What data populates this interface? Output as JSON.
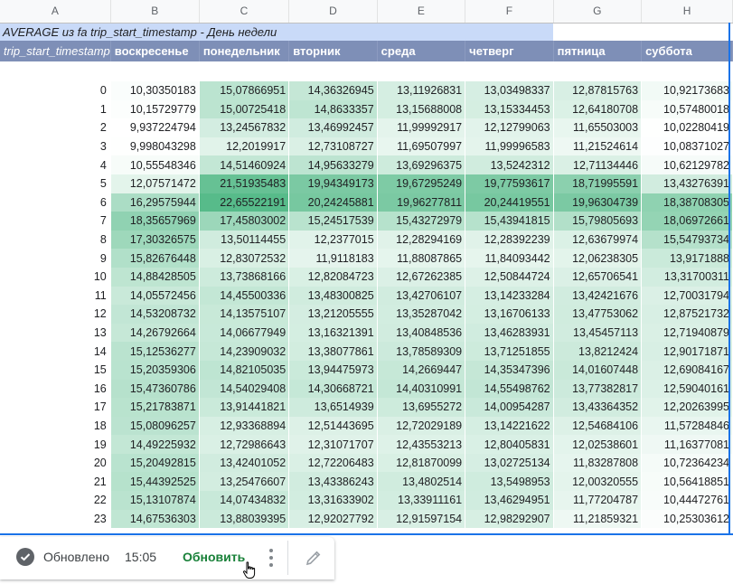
{
  "sheet": {
    "column_letters": [
      "A",
      "B",
      "C",
      "D",
      "E",
      "F",
      "G",
      "H"
    ],
    "title": "AVERAGE из fa trip_start_timestamp - День недели",
    "row_header_label": "trip_start_timestamp",
    "day_headers": [
      "воскресенье",
      "понедельник",
      "вторник",
      "среда",
      "четверг",
      "пятница",
      "суббота"
    ],
    "rows": [
      {
        "hour": "0",
        "values": [
          "10,30350183",
          "15,07866951",
          "14,36326945",
          "13,11926831",
          "13,03498337",
          "12,87815763",
          "10,92173683"
        ]
      },
      {
        "hour": "1",
        "values": [
          "10,15729779",
          "15,00725418",
          "14,8633357",
          "13,15688008",
          "13,15334453",
          "12,64180708",
          "10,57480018"
        ]
      },
      {
        "hour": "2",
        "values": [
          "9,937224794",
          "13,24567832",
          "13,46992457",
          "11,99992917",
          "12,12799063",
          "11,65503003",
          "10,02280419"
        ]
      },
      {
        "hour": "3",
        "values": [
          "9,998043298",
          "12,2019917",
          "12,73108727",
          "11,69507997",
          "11,99996583",
          "11,21524614",
          "10,08371027"
        ]
      },
      {
        "hour": "4",
        "values": [
          "10,55548346",
          "14,51460924",
          "14,95633279",
          "13,69296375",
          "13,5242312",
          "12,71134446",
          "10,62129782"
        ]
      },
      {
        "hour": "5",
        "values": [
          "12,07571472",
          "21,51935483",
          "19,94349173",
          "19,67295249",
          "19,77593617",
          "18,71995591",
          "13,43276391"
        ]
      },
      {
        "hour": "6",
        "values": [
          "16,29575944",
          "22,65522191",
          "20,24245881",
          "19,96277811",
          "20,24419551",
          "19,96304739",
          "18,38708305"
        ]
      },
      {
        "hour": "7",
        "values": [
          "18,35657969",
          "17,45803002",
          "15,24517539",
          "15,43272979",
          "15,43941815",
          "15,79805693",
          "18,06972661"
        ]
      },
      {
        "hour": "8",
        "values": [
          "17,30326575",
          "13,50114455",
          "12,2377015",
          "12,28294169",
          "12,28392239",
          "12,63679974",
          "15,54793734"
        ]
      },
      {
        "hour": "9",
        "values": [
          "15,82676448",
          "12,83072532",
          "11,9118183",
          "11,88087865",
          "11,84093442",
          "12,06238305",
          "13,9171888"
        ]
      },
      {
        "hour": "10",
        "values": [
          "14,88428505",
          "13,73868166",
          "12,82084723",
          "12,67262385",
          "12,50844724",
          "12,65706541",
          "13,31700311"
        ]
      },
      {
        "hour": "11",
        "values": [
          "14,05572456",
          "14,45500336",
          "13,48300825",
          "13,42706107",
          "13,14233284",
          "13,42421676",
          "12,70031794"
        ]
      },
      {
        "hour": "12",
        "values": [
          "14,53208732",
          "14,13575107",
          "13,21205555",
          "13,35287042",
          "13,16706133",
          "13,47753062",
          "12,87521732"
        ]
      },
      {
        "hour": "13",
        "values": [
          "14,26792664",
          "14,06677949",
          "13,16321391",
          "13,40848536",
          "13,46283931",
          "13,45457113",
          "12,71940879"
        ]
      },
      {
        "hour": "14",
        "values": [
          "15,12536277",
          "14,23909032",
          "13,38077861",
          "13,78589309",
          "13,71251855",
          "13,8212424",
          "12,90171871"
        ]
      },
      {
        "hour": "15",
        "values": [
          "15,20359306",
          "14,82105035",
          "13,94475973",
          "14,2669447",
          "14,35347396",
          "14,01607448",
          "12,69084167"
        ]
      },
      {
        "hour": "16",
        "values": [
          "15,47360786",
          "14,54029408",
          "14,30668721",
          "14,40310991",
          "14,55498762",
          "13,77382817",
          "12,59040161"
        ]
      },
      {
        "hour": "17",
        "values": [
          "15,21783871",
          "13,91441821",
          "13,6514939",
          "13,6955272",
          "14,00954287",
          "13,43364352",
          "12,20263995"
        ]
      },
      {
        "hour": "18",
        "values": [
          "15,08096257",
          "12,93368894",
          "12,51443695",
          "12,72029189",
          "13,14221622",
          "12,54684106",
          "11,57284846"
        ]
      },
      {
        "hour": "19",
        "values": [
          "14,49225932",
          "12,72986643",
          "12,31071707",
          "12,43553213",
          "12,80405831",
          "12,02538601",
          "11,16377081"
        ]
      },
      {
        "hour": "20",
        "values": [
          "15,20492815",
          "13,42401052",
          "12,72206483",
          "12,81870099",
          "13,02725134",
          "11,83287808",
          "10,72364234"
        ]
      },
      {
        "hour": "21",
        "values": [
          "15,44392525",
          "13,25476607",
          "13,43386243",
          "13,4802514",
          "13,5498953",
          "12,00320555",
          "10,56418851"
        ]
      },
      {
        "hour": "22",
        "values": [
          "15,13107874",
          "14,07434832",
          "13,31633902",
          "13,33911161",
          "13,46294951",
          "11,77204787",
          "10,44472761"
        ]
      },
      {
        "hour": "23",
        "values": [
          "14,67536303",
          "13,88039395",
          "12,92027792",
          "12,91597154",
          "12,98292907",
          "11,21859321",
          "10,25303612"
        ]
      }
    ]
  },
  "colors": {
    "title_bg": "#c9daf8",
    "header_bg": "#7e8fb7",
    "scale_low": "#ffffff",
    "scale_high": "#57bb8a",
    "accent": "#188038",
    "selection": "#1a73e8"
  },
  "status": {
    "label": "Обновлено",
    "time": "15:05",
    "refresh_label": "Обновить",
    "icons": [
      "check-circle-icon",
      "more-vert-icon",
      "pencil-icon",
      "hand-pointer-icon"
    ]
  }
}
